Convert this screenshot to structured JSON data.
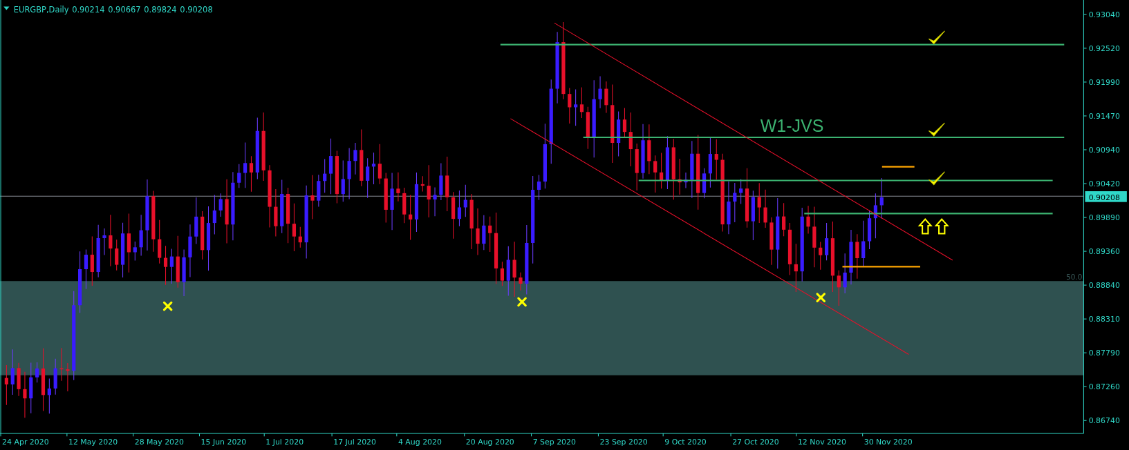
{
  "header": {
    "symbol_timeframe": "EURGBP,Daily",
    "ohlc": [
      "0.90214",
      "0.90667",
      "0.89824",
      "0.90208"
    ]
  },
  "price_axis": [
    "0.93040",
    "0.92520",
    "0.91990",
    "0.91470",
    "0.90940",
    "0.90420",
    "0.89890",
    "0.89360",
    "0.88840",
    "0.88310",
    "0.87790",
    "0.87260",
    "0.86740"
  ],
  "current_price": "0.90208",
  "date_axis": [
    "24 Apr 2020",
    "12 May 2020",
    "28 May 2020",
    "15 Jun 2020",
    "1 Jul 2020",
    "17 Jul 2020",
    "4 Aug 2020",
    "20 Aug 2020",
    "7 Sep 2020",
    "23 Sep 2020",
    "9 Oct 2020",
    "27 Oct 2020",
    "12 Nov 2020",
    "30 Nov 2020"
  ],
  "zone_label": "50.0",
  "annotation": "W1-JVS"
}
